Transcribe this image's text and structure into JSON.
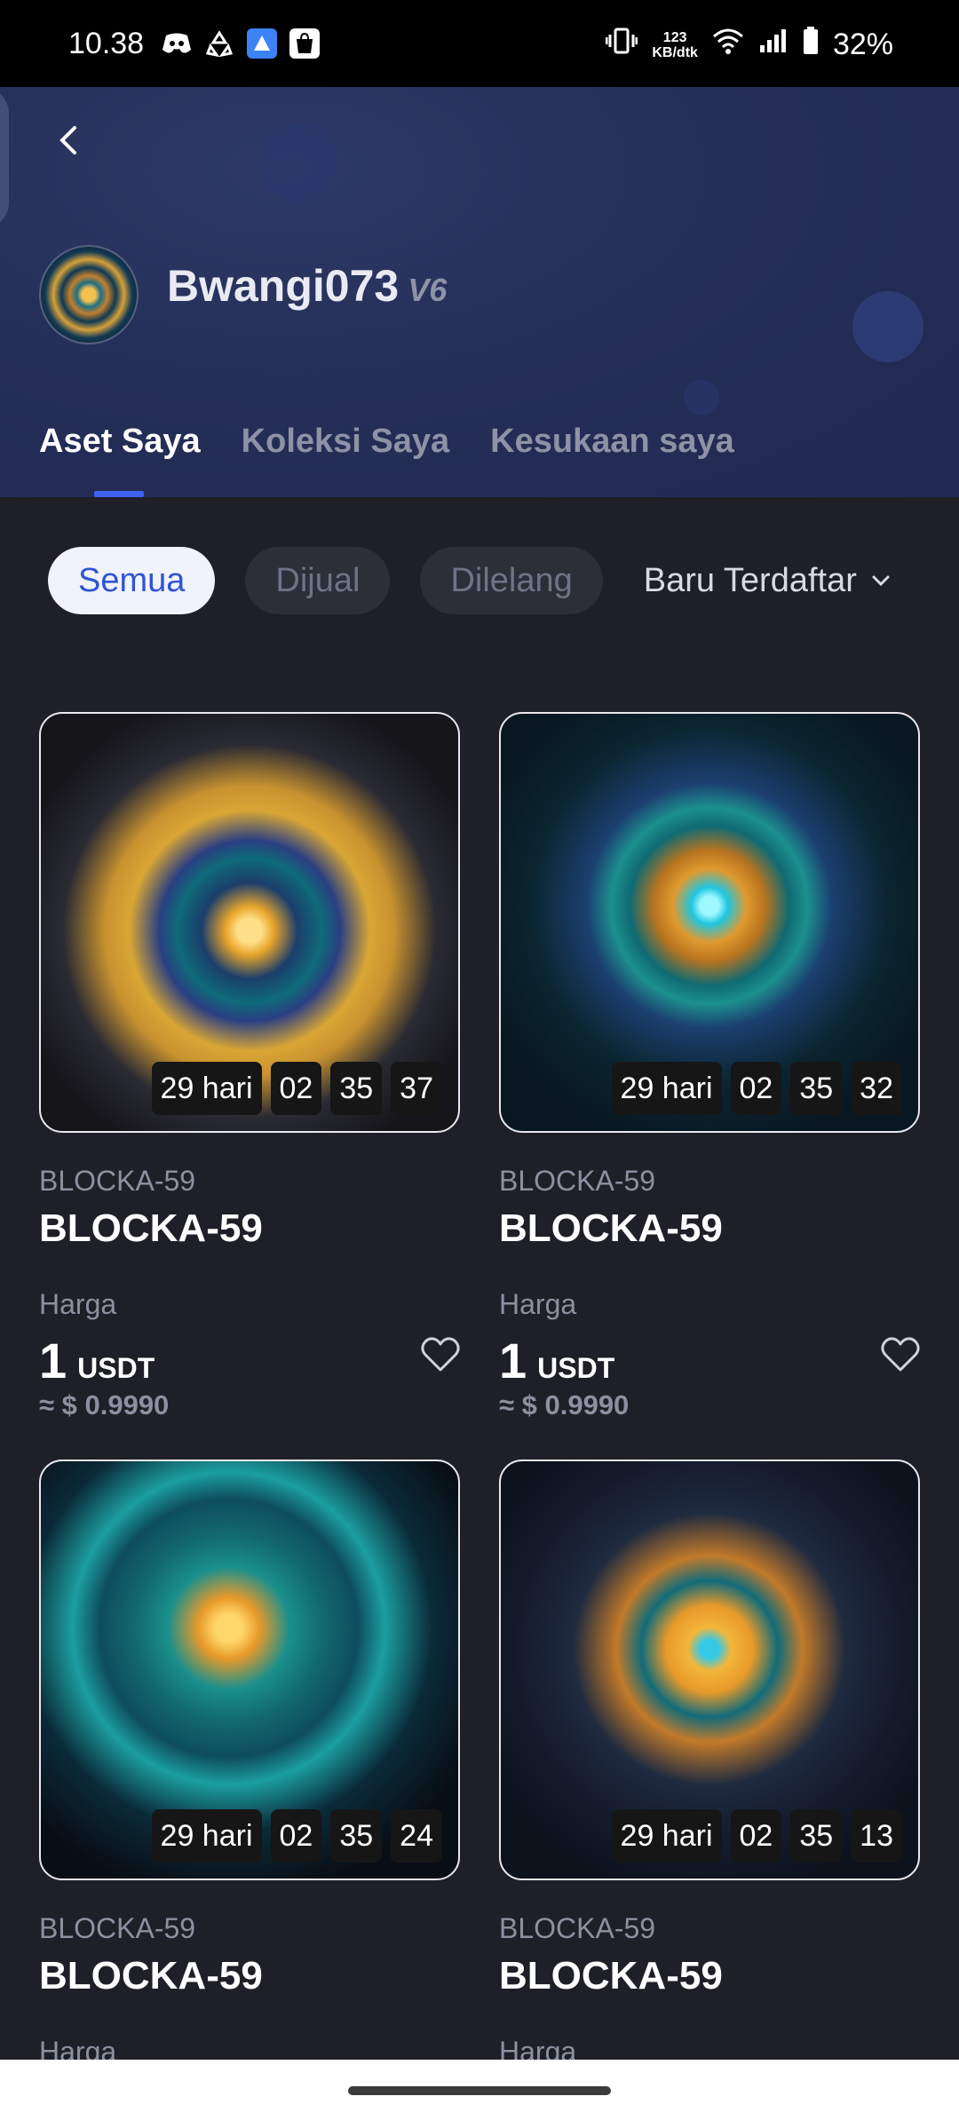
{
  "status_bar": {
    "time": "10.38",
    "speed_value": "123",
    "speed_unit": "KB/dtk",
    "battery": "32%"
  },
  "profile": {
    "username": "Bwangi073",
    "badge": "V6"
  },
  "tabs": [
    {
      "label": "Aset Saya"
    },
    {
      "label": "Koleksi Saya"
    },
    {
      "label": "Kesukaan saya"
    }
  ],
  "filters": {
    "all": "Semua",
    "sale": "Dijual",
    "auction": "Dilelang",
    "sort": "Baru Terdaftar"
  },
  "cards": [
    {
      "collection": "BLOCKA-59",
      "name": "BLOCKA-59",
      "price_label": "Harga",
      "price": "1",
      "unit": "USDT",
      "approx": "≈ $ 0.9990",
      "timer": {
        "days": "29 hari",
        "h": "02",
        "m": "35",
        "s": "37"
      }
    },
    {
      "collection": "BLOCKA-59",
      "name": "BLOCKA-59",
      "price_label": "Harga",
      "price": "1",
      "unit": "USDT",
      "approx": "≈ $ 0.9990",
      "timer": {
        "days": "29 hari",
        "h": "02",
        "m": "35",
        "s": "32"
      }
    },
    {
      "collection": "BLOCKA-59",
      "name": "BLOCKA-59",
      "price_label": "Harga",
      "timer": {
        "days": "29 hari",
        "h": "02",
        "m": "35",
        "s": "24"
      }
    },
    {
      "collection": "BLOCKA-59",
      "name": "BLOCKA-59",
      "price_label": "Harga",
      "timer": {
        "days": "29 hari",
        "h": "02",
        "m": "35",
        "s": "13"
      }
    }
  ],
  "colors": {
    "accent": "#3f62f0",
    "header_bg": "#25305a",
    "page_bg": "#1e1f27"
  }
}
